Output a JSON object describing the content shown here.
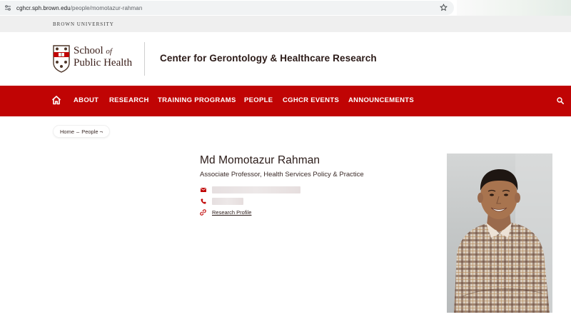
{
  "browser": {
    "url_host": "cghcr.sph.brown.edu",
    "url_path": "/people/momotazur-rahman"
  },
  "brand": {
    "university": "BROWN UNIVERSITY",
    "school_line1": "School",
    "school_of": "of",
    "school_line2": "Public Health",
    "center_title": "Center for Gerontology & Healthcare Research"
  },
  "nav": {
    "items": [
      {
        "label": "ABOUT"
      },
      {
        "label": "RESEARCH"
      },
      {
        "label": "TRAINING PROGRAMS"
      },
      {
        "label": "PEOPLE"
      },
      {
        "label": "CGHCR EVENTS"
      },
      {
        "label": "ANNOUNCEMENTS"
      }
    ],
    "icons": {
      "home": "home-icon",
      "search": "search-icon"
    }
  },
  "breadcrumb": {
    "home": "Home",
    "separator": "–",
    "current": "People",
    "trail_mark": "¬"
  },
  "profile": {
    "name": "Md Momotazur Rahman",
    "title": "Associate Professor, Health Services Policy & Practice",
    "research_profile_label": "Research Profile",
    "icons": {
      "email": "envelope-icon",
      "phone": "phone-icon",
      "link": "link-icon"
    }
  },
  "colors": {
    "brand_red": "#c00404",
    "text_dark": "#2a1a17"
  }
}
